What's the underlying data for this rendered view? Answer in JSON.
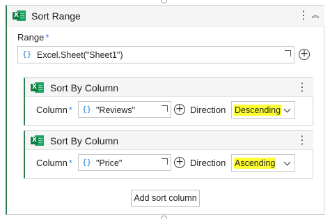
{
  "activity": {
    "title": "Sort Range",
    "menu_icon": "kebab-vertical-icon",
    "collapse_icon": "double-chevron-up-icon"
  },
  "range": {
    "label": "Range",
    "required_mark": "*",
    "braces": "{}",
    "value": "Excel.Sheet(\"Sheet1\")"
  },
  "sort_columns": [
    {
      "title": "Sort By Column",
      "column_label": "Column",
      "required_mark": "*",
      "braces": "{}",
      "column_value": "\"Reviews\"",
      "direction_label": "Direction",
      "direction_value": "Descending"
    },
    {
      "title": "Sort By Column",
      "column_label": "Column",
      "required_mark": "*",
      "braces": "{}",
      "column_value": "\"Price\"",
      "direction_label": "Direction",
      "direction_value": "Ascending"
    }
  ],
  "add_sort_column_label": "Add sort column",
  "colors": {
    "accent_green": "#2f7d52",
    "excel_green": "#107c41",
    "required_blue": "#3b82f6",
    "highlight_yellow": "#ffff33"
  }
}
